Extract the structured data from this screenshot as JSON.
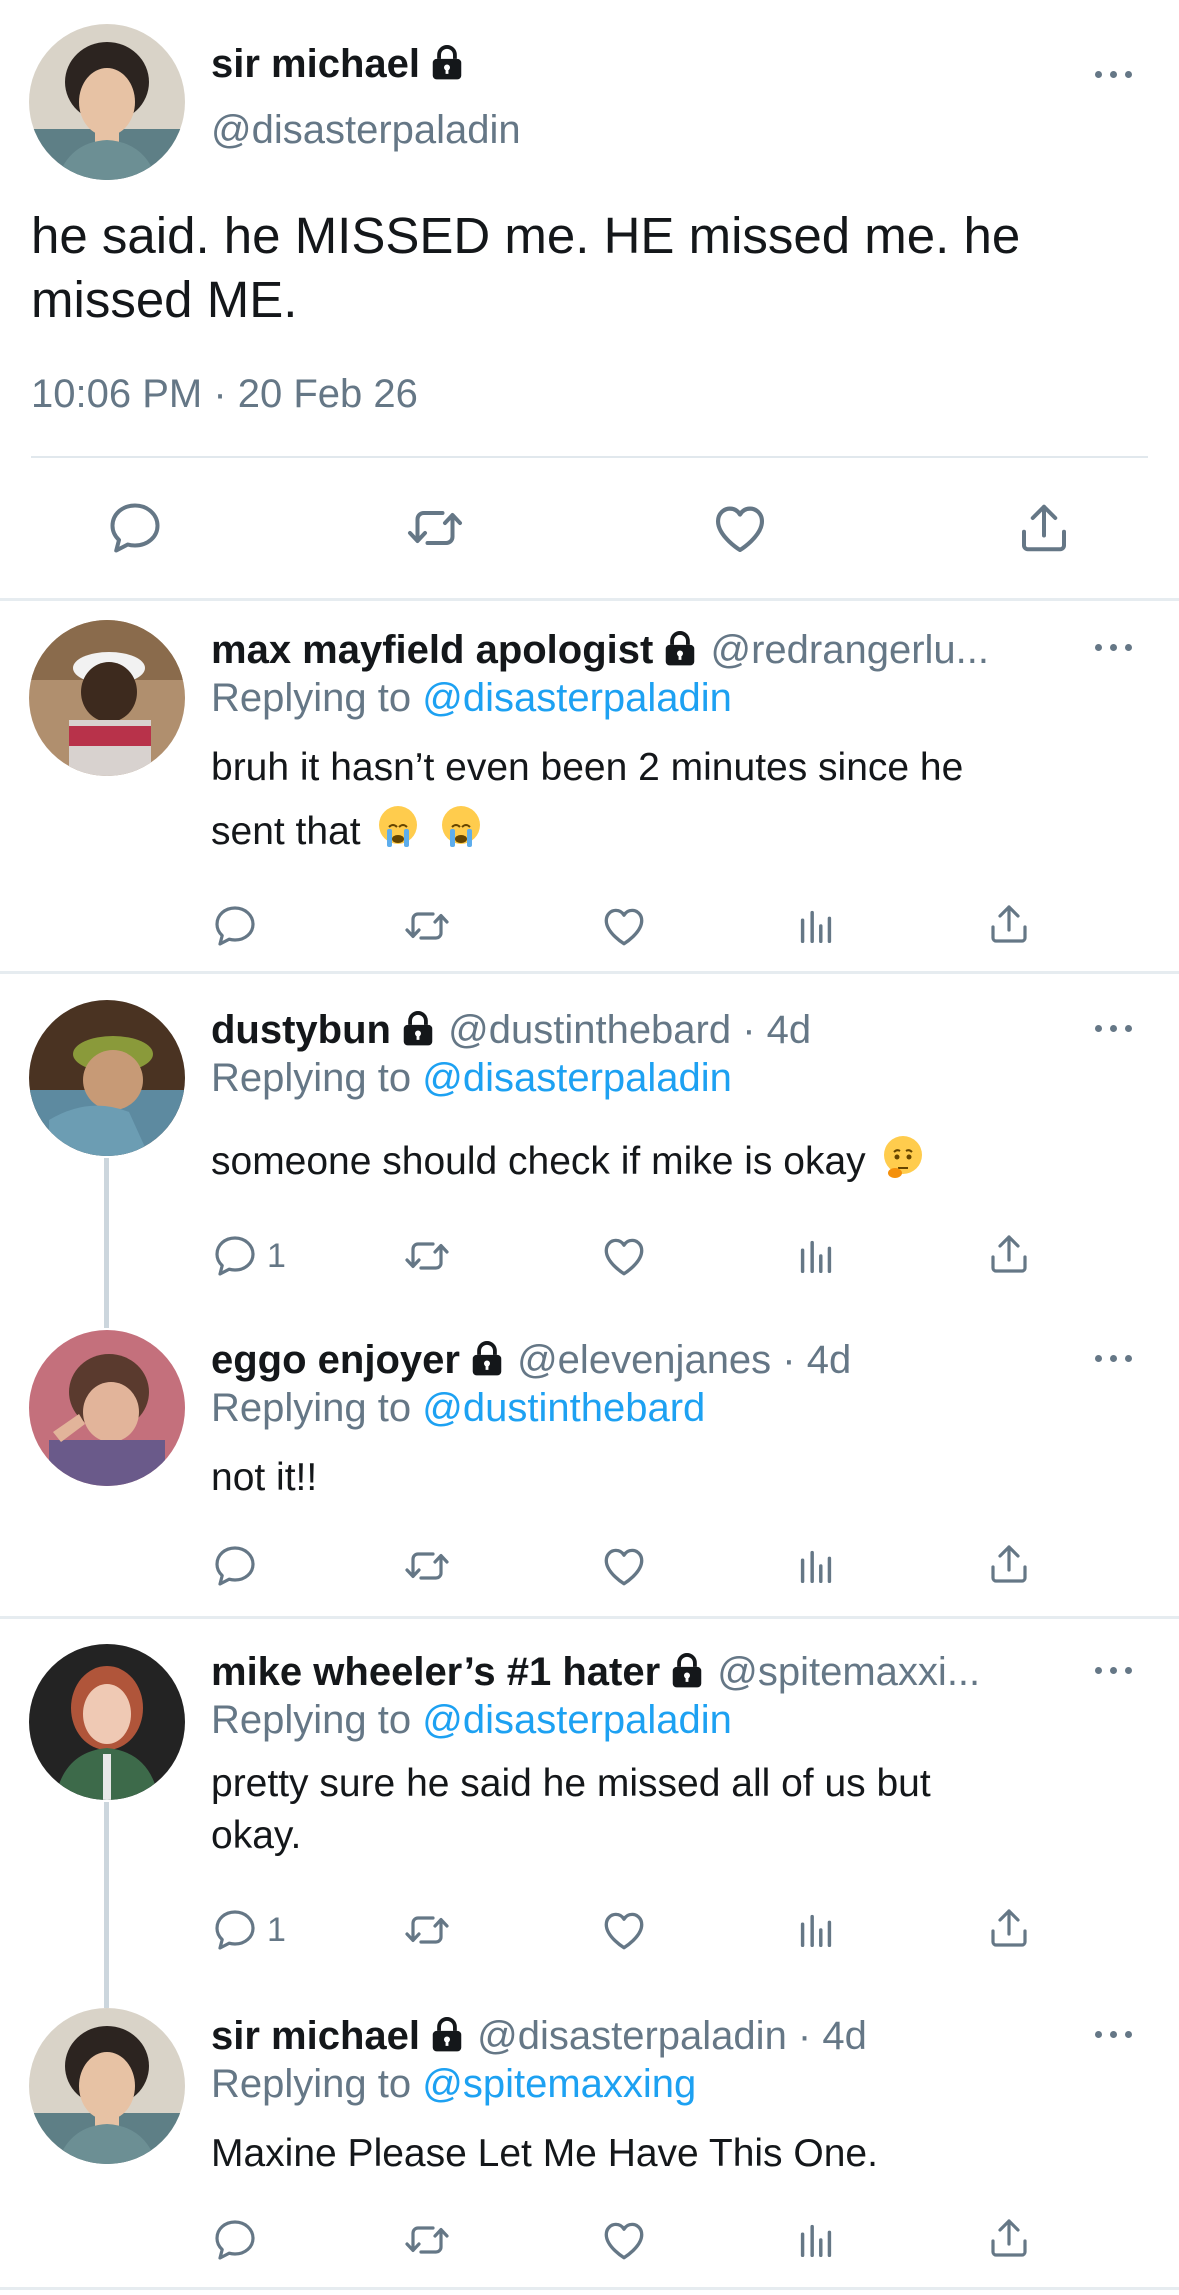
{
  "main_tweet": {
    "display_name": "sir michael",
    "handle": "@disasterpaladin",
    "text_line1": "he said. he MISSED me. HE missed me. he",
    "text_line2": "missed ME.",
    "timestamp": "10:06 PM · 20 Feb 26"
  },
  "replies": [
    {
      "display_name": "max mayfield apologist",
      "handle": "@redrangerlu...",
      "replying_prefix": "Replying to",
      "replying_to": "@disasterpaladin",
      "text_line1": "bruh it hasn’t even been 2 minutes since he",
      "text_line2": "sent that",
      "reply_count": ""
    },
    {
      "display_name": "dustybun",
      "handle": "@dustinthebard · 4d",
      "replying_prefix": "Replying to",
      "replying_to": "@disasterpaladin",
      "text_line1": "someone should check if mike is okay",
      "reply_count": "1"
    },
    {
      "display_name": "eggo enjoyer",
      "handle": "@elevenjanes · 4d",
      "replying_prefix": "Replying to",
      "replying_to": "@dustinthebard",
      "text_line1": "not it!!",
      "reply_count": ""
    },
    {
      "display_name": "mike wheeler’s #1 hater",
      "handle": "@spitemaxxi...",
      "replying_prefix": "Replying to",
      "replying_to": "@disasterpaladin",
      "text_line1": "pretty sure he said he missed all of us but",
      "text_line2": "okay.",
      "reply_count": "1"
    },
    {
      "display_name": "sir michael",
      "handle": "@disasterpaladin · 4d",
      "replying_prefix": "Replying to",
      "replying_to": "@spitemaxxing",
      "text_line1": "Maxine Please Let Me Have This One.",
      "reply_count": ""
    }
  ],
  "colors": {
    "text": "#14171a",
    "muted": "#657786",
    "accent": "#1da1f2",
    "divider": "#e6ecf0"
  },
  "icons": [
    "lock-icon",
    "more-icon",
    "reply-icon",
    "retweet-icon",
    "like-icon",
    "analytics-icon",
    "share-icon",
    "loudly-crying-emoji",
    "thinking-emoji"
  ]
}
